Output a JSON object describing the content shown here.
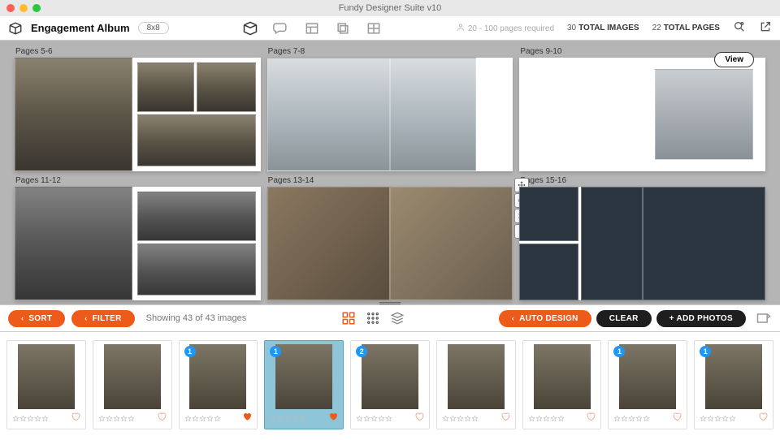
{
  "window": {
    "title": "Fundy Designer Suite v10"
  },
  "header": {
    "album_name": "Engagement Album",
    "size": "8x8",
    "pages_required": "20 - 100 pages required",
    "total_images_count": "30",
    "total_images_label": "TOTAL IMAGES",
    "total_pages_count": "22",
    "total_pages_label": "TOTAL PAGES"
  },
  "spreads": [
    {
      "label": "Pages 5-6"
    },
    {
      "label": "Pages 7-8"
    },
    {
      "label": "Pages 9-10",
      "view_btn": "View"
    },
    {
      "label": "Pages 11-12"
    },
    {
      "label": "Pages 13-14"
    },
    {
      "label": "Pages 15-16"
    }
  ],
  "tools": {
    "move": "move-icon",
    "rotate": "rotate-icon",
    "shuffle": "shuffle-icon",
    "delete": "delete-icon"
  },
  "bottombar": {
    "sort": "SORT",
    "filter": "FILTER",
    "showing": "Showing 43 of 43 images",
    "auto_design": "AUTO DESIGN",
    "clear": "CLEAR",
    "add_photos": "+ ADD PHOTOS"
  },
  "thumbs": [
    {
      "badge": "",
      "fav": "off"
    },
    {
      "badge": "",
      "fav": "off"
    },
    {
      "badge": "1",
      "fav": "on"
    },
    {
      "badge": "1",
      "fav": "on",
      "selected": true
    },
    {
      "badge": "2",
      "fav": "off"
    },
    {
      "badge": "",
      "fav": "off"
    },
    {
      "badge": "",
      "fav": "off"
    },
    {
      "badge": "1",
      "fav": "off"
    },
    {
      "badge": "1",
      "fav": "off"
    }
  ]
}
